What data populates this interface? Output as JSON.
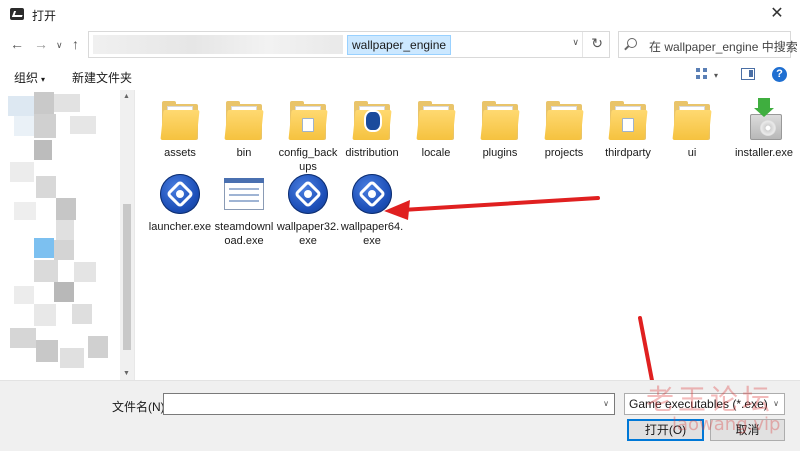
{
  "window": {
    "title": "打开",
    "close_glyph": "✕"
  },
  "navigation": {
    "back_glyph": "←",
    "forward_glyph": "→",
    "history_glyph": "∨",
    "up_glyph": "↑",
    "current_folder": "wallpaper_engine",
    "address_dropdown_glyph": "∨",
    "refresh_glyph": "↻",
    "search_placeholder": "在 wallpaper_engine 中搜索"
  },
  "toolbar": {
    "organize_label": "组织",
    "organize_caret": "▾",
    "new_folder_label": "新建文件夹",
    "view_caret": "▾",
    "help_glyph": "?"
  },
  "files": [
    {
      "label": "assets",
      "icon": "folder-icon"
    },
    {
      "label": "bin",
      "icon": "folder-icon"
    },
    {
      "label": "config_backups",
      "icon": "folder-icon"
    },
    {
      "label": "distribution",
      "icon": "folder-icon"
    },
    {
      "label": "locale",
      "icon": "folder-icon"
    },
    {
      "label": "plugins",
      "icon": "folder-icon"
    },
    {
      "label": "projects",
      "icon": "folder-icon"
    },
    {
      "label": "thirdparty",
      "icon": "folder-icon"
    },
    {
      "label": "ui",
      "icon": "folder-icon"
    },
    {
      "label": "installer.exe",
      "icon": "installer-icon"
    },
    {
      "label": "launcher.exe",
      "icon": "wallpaper-engine-icon"
    },
    {
      "label": "steamdownload.exe",
      "icon": "steam-window-icon"
    },
    {
      "label": "wallpaper32.exe",
      "icon": "wallpaper-engine-icon"
    },
    {
      "label": "wallpaper64.exe",
      "icon": "wallpaper-engine-icon"
    }
  ],
  "bottom": {
    "filename_label": "文件名(N):",
    "filename_value": "",
    "filetype_value": "Game executables (*.exe)",
    "open_button": "打开(O)",
    "cancel_button": "取消",
    "dropdown_caret": "∨"
  },
  "scrollbar": {
    "up_glyph": "▲",
    "down_glyph": "▼"
  },
  "watermark": {
    "main": "老王论坛",
    "sub": "laowang.vip"
  },
  "colors": {
    "accent": "#0078d7",
    "address_highlight": "#cce8ff",
    "annotation_red": "#e02020",
    "folder_yellow": "#f5c23f"
  }
}
